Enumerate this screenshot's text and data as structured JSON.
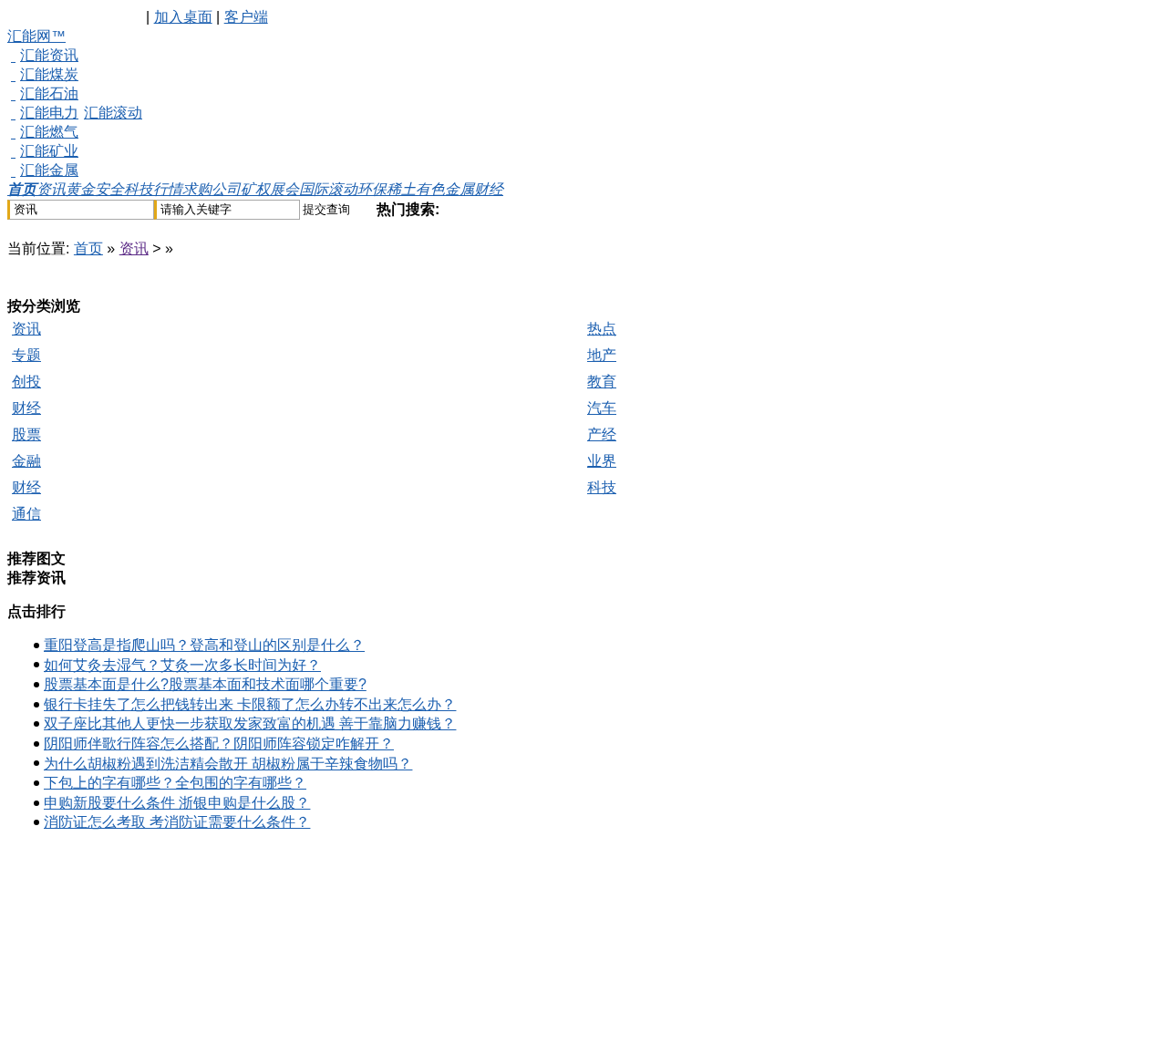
{
  "top_bar": [
    {
      "kind": "separator",
      "text": "|"
    },
    {
      "kind": "link",
      "text": "加入桌面"
    },
    {
      "kind": "separator",
      "text": "|"
    },
    {
      "kind": "link",
      "text": "客户端"
    }
  ],
  "site_logo": "汇能网™",
  "site_links": [
    {
      "links": [
        "汇能资讯"
      ]
    },
    {
      "links": [
        "汇能煤炭"
      ]
    },
    {
      "links": [
        "汇能石油"
      ]
    },
    {
      "links": [
        "汇能电力",
        "汇能滚动"
      ]
    },
    {
      "links": [
        "汇能燃气"
      ]
    },
    {
      "links": [
        "汇能矿业"
      ]
    },
    {
      "links": [
        "汇能金属"
      ]
    }
  ],
  "nav": [
    {
      "label": "首页",
      "selected": true
    },
    {
      "label": "资讯",
      "selected": false
    },
    {
      "label": "黄金",
      "selected": false
    },
    {
      "label": "安全",
      "selected": false
    },
    {
      "label": "科技",
      "selected": false
    },
    {
      "label": "行情",
      "selected": false
    },
    {
      "label": "求购",
      "selected": false
    },
    {
      "label": "公司",
      "selected": false
    },
    {
      "label": "矿权",
      "selected": false
    },
    {
      "label": "展会",
      "selected": false
    },
    {
      "label": "国际",
      "selected": false
    },
    {
      "label": "滚动",
      "selected": false
    },
    {
      "label": "环保",
      "selected": false
    },
    {
      "label": "稀土",
      "selected": false
    },
    {
      "label": "有色",
      "selected": false
    },
    {
      "label": "金属",
      "selected": false
    },
    {
      "label": "财经",
      "selected": false
    }
  ],
  "search": {
    "category": "资讯",
    "keyword": "请输入关键字",
    "submit": "提交查询",
    "hot_label": "热门搜索:"
  },
  "breadcrumb": [
    {
      "kind": "label",
      "text": "当前位置:"
    },
    {
      "kind": "link",
      "text": "首页",
      "visited": false
    },
    {
      "kind": "separator",
      "text": "»"
    },
    {
      "kind": "link",
      "text": "资讯",
      "visited": true
    },
    {
      "kind": "separator",
      "text": "> »"
    }
  ],
  "categories": {
    "title": "按分类浏览",
    "rows": [
      [
        "资讯",
        "热点"
      ],
      [
        "专题",
        "地产"
      ],
      [
        "创投",
        "教育"
      ],
      [
        "财经",
        "汽车"
      ],
      [
        "股票",
        "产经"
      ],
      [
        "金融",
        "业界"
      ],
      [
        "财经",
        "科技"
      ],
      [
        "通信"
      ]
    ]
  },
  "sections": [
    "推荐图文",
    "推荐资讯"
  ],
  "ranking": {
    "title": "点击排行",
    "items": [
      "重阳登高是指爬山吗？登高和登山的区别是什么？",
      "如何艾灸去湿气？艾灸一次多长时间为好？",
      "股票基本面是什么?股票基本面和技术面哪个重要?",
      "银行卡挂失了怎么把钱转出来 卡限额了怎么办转不出来怎么办？",
      "双子座比其他人更快一步获取发家致富的机遇 善于靠脑力赚钱？",
      "阴阳师伴歌行阵容怎么搭配？阴阳师阵容锁定咋解开？",
      "为什么胡椒粉遇到洗洁精会散开 胡椒粉属于辛辣食物吗？",
      "下包上的字有哪些？全包围的字有哪些？",
      "申购新股要什么条件 浙银申购是什么股？",
      "消防证怎么考取 考消防证需要什么条件？"
    ]
  }
}
